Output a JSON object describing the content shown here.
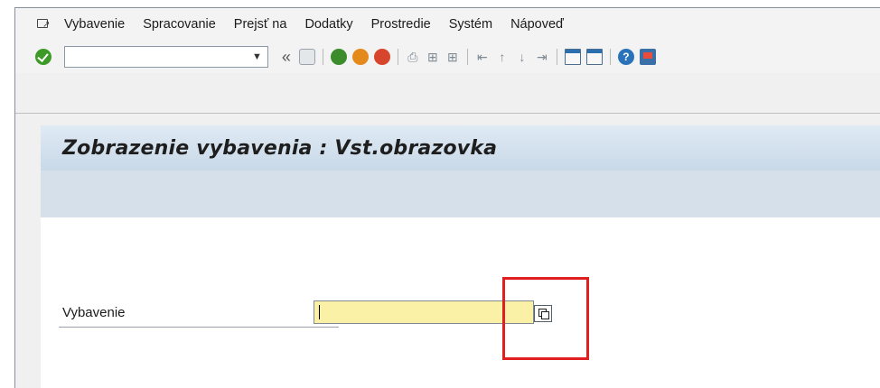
{
  "menubar": {
    "items": [
      "Vybavenie",
      "Spracovanie",
      "Prejsť na",
      "Dodatky",
      "Prostredie",
      "Systém",
      "Nápoveď"
    ]
  },
  "toolbar": {
    "command_field_value": "",
    "nav_back_symbol": "«",
    "icons": [
      "save-icon",
      "back-icon",
      "exit-icon",
      "cancel-icon",
      "print-icon",
      "find-icon",
      "find-next-icon",
      "first-page-icon",
      "previous-page-icon",
      "next-page-icon",
      "last-page-icon",
      "new-session-icon",
      "shortcut-icon",
      "help-icon",
      "customize-layout-icon"
    ]
  },
  "screen": {
    "title": "Zobrazenie vybavenia : Vst.obrazovka"
  },
  "form": {
    "vybavenie_label": "Vybavenie",
    "vybavenie_value": ""
  },
  "colors": {
    "title_bar": "#c9d9e8",
    "input_required": "#fbf1a6",
    "highlight": "#e02020",
    "ok_green": "#3d9a26"
  }
}
